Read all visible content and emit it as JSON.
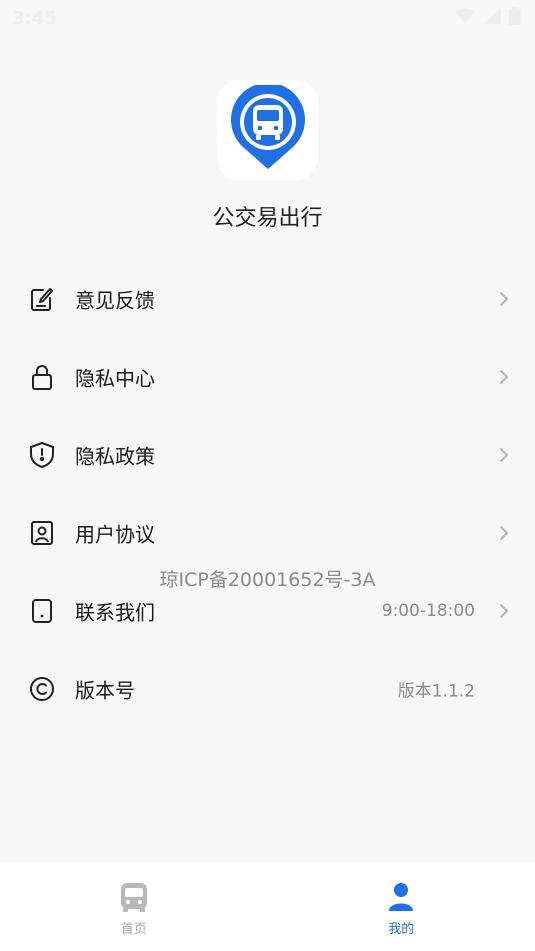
{
  "status_bar": {
    "time": "3:45",
    "icons": [
      "wifi-icon",
      "cellular-signal-icon",
      "battery-icon"
    ]
  },
  "app": {
    "name": "公交易出行",
    "logo_icon": "bus-location-pin-icon",
    "accent_color": "#1f6fe5"
  },
  "menu": {
    "items": [
      {
        "label": "意见反馈",
        "icon": "feedback-edit-icon",
        "value": "",
        "has_chevron": true
      },
      {
        "label": "隐私中心",
        "icon": "lock-icon",
        "value": "",
        "has_chevron": true
      },
      {
        "label": "隐私政策",
        "icon": "shield-icon",
        "value": "",
        "has_chevron": true
      },
      {
        "label": "用户协议",
        "icon": "user-card-icon",
        "value": "",
        "has_chevron": true
      },
      {
        "label": "联系我们",
        "icon": "phone-icon",
        "value": "9:00-18:00",
        "has_chevron": true
      },
      {
        "label": "版本号",
        "icon": "copyright-icon",
        "value": "版本1.1.2",
        "has_chevron": false
      }
    ]
  },
  "icp": "琼ICP备20001652号-3A",
  "tab_bar": {
    "tabs": [
      {
        "label": "首页",
        "icon": "bus-icon",
        "active": false
      },
      {
        "label": "我的",
        "icon": "person-icon",
        "active": true
      }
    ]
  }
}
